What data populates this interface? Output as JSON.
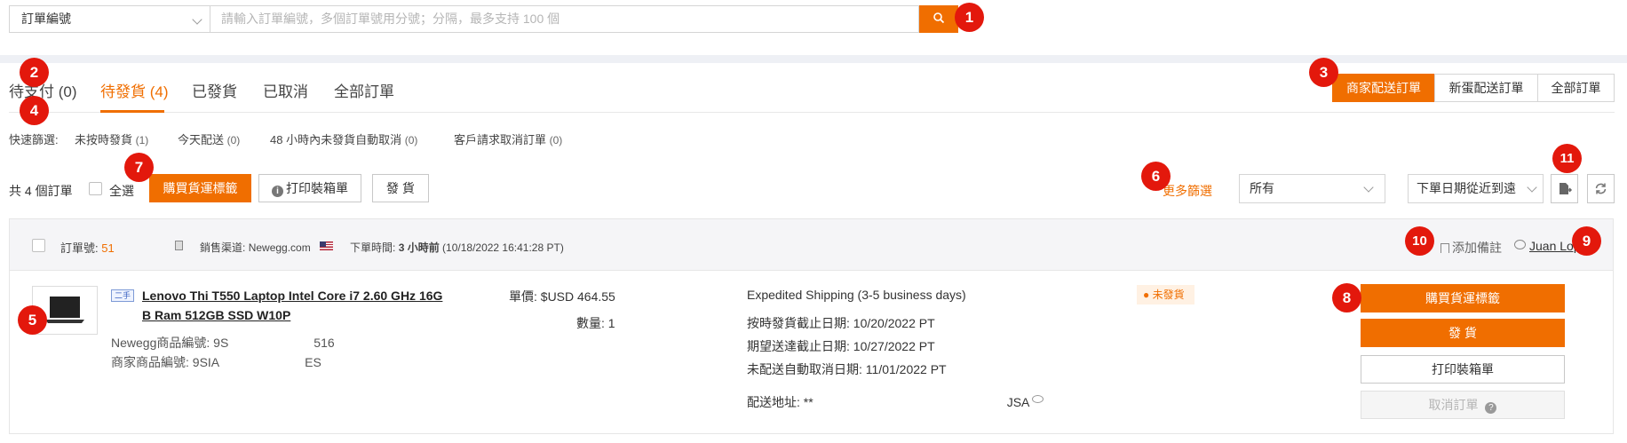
{
  "search": {
    "field_selected": "訂單編號",
    "placeholder": "請輸入訂單編號，多個訂單號用分號；分隔，最多支持 100 個"
  },
  "tabs": [
    {
      "label": "待支付 (0)"
    },
    {
      "label": "待發貨 (4)"
    },
    {
      "label": "已發貨"
    },
    {
      "label": "已取消"
    },
    {
      "label": "全部訂單"
    }
  ],
  "delivery_segments": [
    {
      "label": "商家配送訂單"
    },
    {
      "label": "新蛋配送訂單"
    },
    {
      "label": "全部訂單"
    }
  ],
  "quick_filter": {
    "label": "快速篩選:",
    "items": [
      {
        "label": "未按時發貨",
        "count": "(1)"
      },
      {
        "label": "今天配送",
        "count": "(0)"
      },
      {
        "label": "48 小時內未發貨自動取消",
        "count": "(0)"
      },
      {
        "label": "客戶請求取消訂單",
        "count": "(0)"
      }
    ]
  },
  "toolbar": {
    "total": "共 4 個訂單",
    "select_all": "全選",
    "buy_label": "購買貨運標籤",
    "print_packing": "打印裝箱單",
    "ship": "發 貨",
    "more_filters": "更多篩選",
    "filter_value": "所有",
    "sort_value": "下單日期從近到遠"
  },
  "order": {
    "number_label": "訂單號:",
    "number_visible": "51",
    "channel_label": "銷售渠道:",
    "channel": "Newegg.com",
    "time_label": "下單時間:",
    "time_ago": "3 小時前",
    "time_full": "(10/18/2022 16:41:28 PT)",
    "add_note": "添加備註",
    "customer": "Juan Lop",
    "condition_tag": "二手",
    "title_line1": "Lenovo Thi        T550 Laptop Intel Core i7 2.60 GHz 16G",
    "title_line2": "B Ram 512GB SSD W10P",
    "newegg_item_label": "Newegg商品編號:",
    "newegg_item_start": "9S",
    "newegg_item_end": "516",
    "seller_item_label": "商家商品編號:",
    "seller_item_start": "9SIA",
    "seller_item_end": "ES",
    "unit_price_label": "單價:",
    "unit_price": "$USD 464.55",
    "qty_label": "數量:",
    "qty": "1",
    "shipping_method": "Expedited Shipping (3-5 business days)",
    "ship_by_label": "按時發貨截止日期:",
    "ship_by": "10/20/2022 PT",
    "deliver_by_label": "期望送達截止日期:",
    "deliver_by": "10/27/2022 PT",
    "auto_cancel_label": "未配送自動取消日期:",
    "auto_cancel": "11/01/2022 PT",
    "address_label": "配送地址:",
    "address_start": "**",
    "address_end": "JSA",
    "status": "未發貨",
    "actions": {
      "buy_label": "購買貨運標籤",
      "ship": "發 貨",
      "print_packing": "打印裝箱單",
      "cancel": "取消訂單"
    }
  },
  "annotations": [
    "1",
    "2",
    "3",
    "4",
    "5",
    "6",
    "7",
    "8",
    "9",
    "10",
    "11"
  ],
  "colors": {
    "accent": "#f06e00",
    "annotation": "#e3180c"
  }
}
